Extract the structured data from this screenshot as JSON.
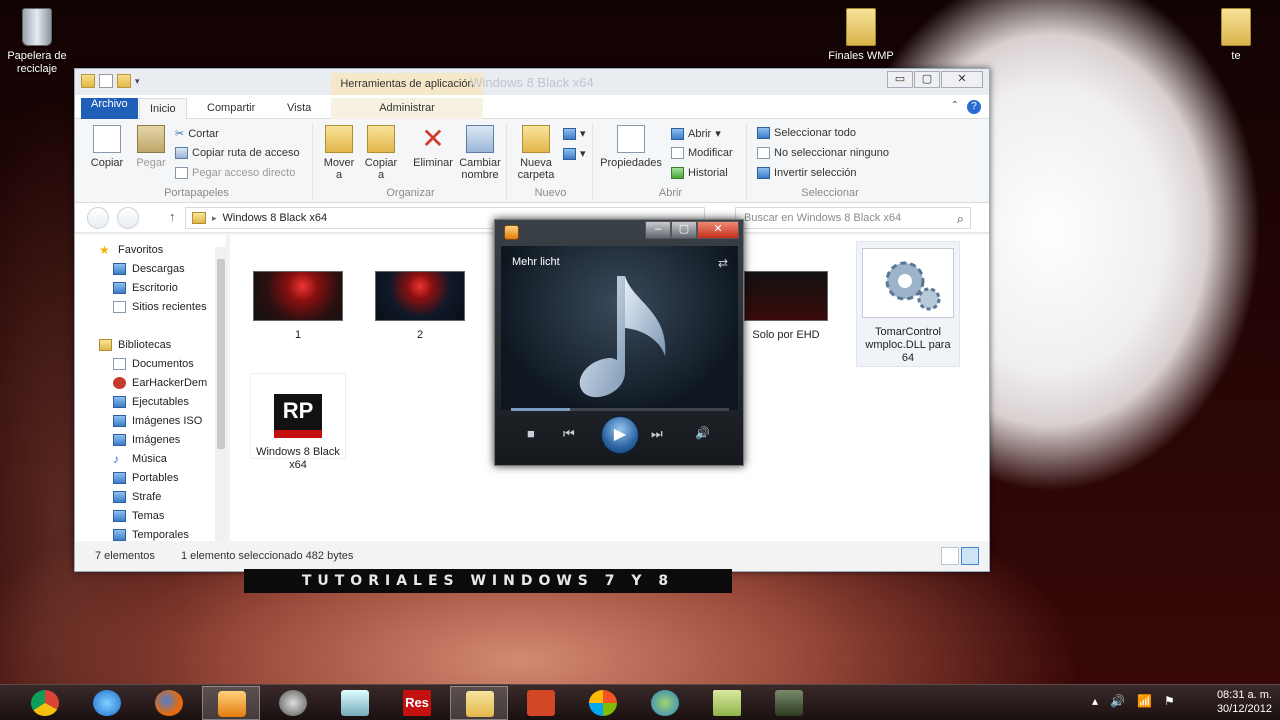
{
  "desktop": {
    "icons": [
      {
        "label": "Papelera de reciclaje"
      },
      {
        "label": "Finales WMP"
      },
      {
        "label": "te"
      }
    ],
    "tagline": "TUTORIALES WINDOWS 7 Y 8"
  },
  "explorer": {
    "title": "Windows 8 Black x64",
    "context_tab": "Herramientas de aplicación",
    "window_buttons": {
      "minimize": "▭",
      "maximize": "▢",
      "close": "✕"
    },
    "tabs": [
      "Archivo",
      "Inicio",
      "Compartir",
      "Vista",
      "Administrar"
    ],
    "ribbon": {
      "portapapeles": {
        "label": "Portapapeles",
        "copiar": "Copiar",
        "pegar": "Pegar",
        "cortar": "Cortar",
        "copiar_ruta": "Copiar ruta de acceso",
        "pegar_acceso": "Pegar acceso directo"
      },
      "organizar": {
        "label": "Organizar",
        "mover": "Mover a",
        "copiar": "Copiar a",
        "eliminar": "Eliminar",
        "cambiar": "Cambiar nombre"
      },
      "nuevo": {
        "label": "Nuevo",
        "nueva_carpeta": "Nueva carpeta"
      },
      "abrir": {
        "label": "Abrir",
        "propiedades": "Propiedades",
        "abrir": "Abrir",
        "modificar": "Modificar",
        "historial": "Historial"
      },
      "seleccionar": {
        "label": "Seleccionar",
        "todo": "Seleccionar todo",
        "ninguno": "No seleccionar ninguno",
        "invertir": "Invertir selección"
      }
    },
    "address": {
      "path": "Windows 8 Black x64",
      "search_placeholder": "Buscar en Windows 8 Black x64"
    },
    "nav": {
      "favoritos": "Favoritos",
      "favorites": [
        "Descargas",
        "Escritorio",
        "Sitios recientes"
      ],
      "bibliotecas": "Bibliotecas",
      "libraries": [
        "Documentos",
        "EarHackerDem",
        "Ejecutables",
        "Imágenes ISO",
        "Imágenes",
        "Música",
        "Portables",
        "Strafe",
        "Temas",
        "Temporales"
      ]
    },
    "files": [
      {
        "name": "1"
      },
      {
        "name": "2"
      },
      {
        "name": "Solo por EHD"
      },
      {
        "name": "TomarControl wmploc.DLL para 64"
      },
      {
        "name": "Windows 8 Black x64",
        "thumb_text": "RP"
      }
    ],
    "status": {
      "count": "7 elementos",
      "selected": "1 elemento seleccionado  482 bytes"
    }
  },
  "player": {
    "track": "Mehr licht",
    "progress": 0.27,
    "controls": {
      "stop": "■",
      "prev": "⏮",
      "play": "▶",
      "next": "⏭",
      "volume": "🔊"
    }
  },
  "taskbar": {
    "apps": [
      "chrome-icon",
      "ie-icon",
      "firefox-icon",
      "media-player-icon",
      "app-icon",
      "notes-icon",
      "res-icon",
      "explorer-icon",
      "powerpoint-icon",
      "windows-icon",
      "messenger-icon",
      "sticky-icon",
      "tools-icon"
    ],
    "res_label": "Res",
    "time": "08:31 a. m.",
    "date": "30/12/2012"
  },
  "colors": {
    "file_tab": "#1f5fb8",
    "context_tab": "#f5e8c8",
    "close_red": "#c3301c"
  }
}
